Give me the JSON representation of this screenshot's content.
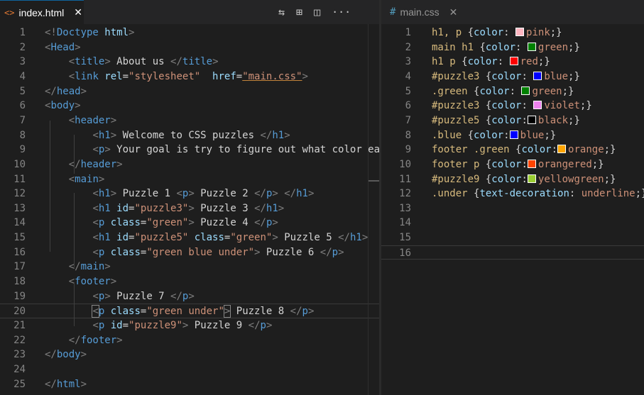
{
  "left_editor": {
    "tab": {
      "icon": "<>",
      "title": "index.html",
      "close": "✕"
    },
    "actions": [
      "⇆",
      "⊞",
      "◫",
      "···"
    ],
    "lines": [
      {
        "n": "1",
        "segs": [
          [
            "<!",
            "#808080"
          ],
          [
            "Doctype",
            "#569cd6"
          ],
          [
            " html",
            "#9cdcfe"
          ],
          [
            ">",
            "#808080"
          ]
        ]
      },
      {
        "n": "2",
        "segs": [
          [
            "<",
            "#808080"
          ],
          [
            "Head",
            "#569cd6"
          ],
          [
            ">",
            "#808080"
          ]
        ]
      },
      {
        "n": "3",
        "segs": [
          [
            "    ",
            "#d4d4d4"
          ],
          [
            "<",
            "#808080"
          ],
          [
            "title",
            "#569cd6"
          ],
          [
            ">",
            "#808080"
          ],
          [
            " About us ",
            "#d4d4d4"
          ],
          [
            "</",
            "#808080"
          ],
          [
            "title",
            "#569cd6"
          ],
          [
            ">",
            "#808080"
          ]
        ]
      },
      {
        "n": "4",
        "segs": [
          [
            "    ",
            "#d4d4d4"
          ],
          [
            "<",
            "#808080"
          ],
          [
            "link",
            "#569cd6"
          ],
          [
            " rel",
            "#9cdcfe"
          ],
          [
            "=",
            "#d4d4d4"
          ],
          [
            "\"stylesheet\"",
            "#ce9178"
          ],
          [
            "  href",
            "#9cdcfe"
          ],
          [
            "=",
            "#d4d4d4"
          ],
          [
            "\"main.css\"",
            "#ce9178",
            "squiggle"
          ],
          [
            ">",
            "#808080"
          ]
        ]
      },
      {
        "n": "5",
        "segs": [
          [
            "</",
            "#808080"
          ],
          [
            "head",
            "#569cd6"
          ],
          [
            ">",
            "#808080"
          ]
        ]
      },
      {
        "n": "6",
        "segs": [
          [
            "<",
            "#808080"
          ],
          [
            "body",
            "#569cd6"
          ],
          [
            ">",
            "#808080"
          ]
        ]
      },
      {
        "n": "7",
        "segs": [
          [
            "    ",
            "#d4d4d4"
          ],
          [
            "<",
            "#808080"
          ],
          [
            "header",
            "#569cd6"
          ],
          [
            ">",
            "#808080"
          ]
        ]
      },
      {
        "n": "8",
        "segs": [
          [
            "        ",
            "#d4d4d4"
          ],
          [
            "<",
            "#808080"
          ],
          [
            "h1",
            "#569cd6"
          ],
          [
            ">",
            "#808080"
          ],
          [
            " Welcome to CSS puzzles ",
            "#d4d4d4"
          ],
          [
            "</",
            "#808080"
          ],
          [
            "h1",
            "#569cd6"
          ],
          [
            ">",
            "#808080"
          ]
        ]
      },
      {
        "n": "9",
        "segs": [
          [
            "        ",
            "#d4d4d4"
          ],
          [
            "<",
            "#808080"
          ],
          [
            "p",
            "#569cd6"
          ],
          [
            ">",
            "#808080"
          ],
          [
            " Your goal is try to figure out what color ea",
            "#d4d4d4"
          ]
        ]
      },
      {
        "n": "10",
        "segs": [
          [
            "    ",
            "#d4d4d4"
          ],
          [
            "</",
            "#808080"
          ],
          [
            "header",
            "#569cd6"
          ],
          [
            ">",
            "#808080"
          ]
        ]
      },
      {
        "n": "11",
        "segs": [
          [
            "    ",
            "#d4d4d4"
          ],
          [
            "<",
            "#808080"
          ],
          [
            "main",
            "#569cd6"
          ],
          [
            ">",
            "#808080"
          ]
        ]
      },
      {
        "n": "12",
        "segs": [
          [
            "        ",
            "#d4d4d4"
          ],
          [
            "<",
            "#808080"
          ],
          [
            "h1",
            "#569cd6"
          ],
          [
            ">",
            "#808080"
          ],
          [
            " Puzzle 1 ",
            "#d4d4d4"
          ],
          [
            "<",
            "#808080"
          ],
          [
            "p",
            "#569cd6"
          ],
          [
            ">",
            "#808080"
          ],
          [
            " Puzzle 2 ",
            "#d4d4d4"
          ],
          [
            "</",
            "#808080"
          ],
          [
            "p",
            "#569cd6"
          ],
          [
            ">",
            "#808080"
          ],
          [
            " ",
            "#d4d4d4"
          ],
          [
            "</",
            "#808080"
          ],
          [
            "h1",
            "#569cd6"
          ],
          [
            ">",
            "#808080"
          ]
        ]
      },
      {
        "n": "13",
        "segs": [
          [
            "        ",
            "#d4d4d4"
          ],
          [
            "<",
            "#808080"
          ],
          [
            "h1",
            "#569cd6"
          ],
          [
            " id",
            "#9cdcfe"
          ],
          [
            "=",
            "#d4d4d4"
          ],
          [
            "\"puzzle3\"",
            "#ce9178"
          ],
          [
            ">",
            "#808080"
          ],
          [
            " Puzzle 3 ",
            "#d4d4d4"
          ],
          [
            "</",
            "#808080"
          ],
          [
            "h1",
            "#569cd6"
          ],
          [
            ">",
            "#808080"
          ]
        ]
      },
      {
        "n": "14",
        "segs": [
          [
            "        ",
            "#d4d4d4"
          ],
          [
            "<",
            "#808080"
          ],
          [
            "p",
            "#569cd6"
          ],
          [
            " class",
            "#9cdcfe"
          ],
          [
            "=",
            "#d4d4d4"
          ],
          [
            "\"green\"",
            "#ce9178"
          ],
          [
            ">",
            "#808080"
          ],
          [
            " Puzzle 4 ",
            "#d4d4d4"
          ],
          [
            "</",
            "#808080"
          ],
          [
            "p",
            "#569cd6"
          ],
          [
            ">",
            "#808080"
          ]
        ]
      },
      {
        "n": "15",
        "segs": [
          [
            "        ",
            "#d4d4d4"
          ],
          [
            "<",
            "#808080"
          ],
          [
            "h1",
            "#569cd6"
          ],
          [
            " id",
            "#9cdcfe"
          ],
          [
            "=",
            "#d4d4d4"
          ],
          [
            "\"puzzle5\"",
            "#ce9178"
          ],
          [
            " class",
            "#9cdcfe"
          ],
          [
            "=",
            "#d4d4d4"
          ],
          [
            "\"green\"",
            "#ce9178"
          ],
          [
            ">",
            "#808080"
          ],
          [
            " Puzzle 5 ",
            "#d4d4d4"
          ],
          [
            "</",
            "#808080"
          ],
          [
            "h1",
            "#569cd6"
          ],
          [
            ">",
            "#808080"
          ]
        ]
      },
      {
        "n": "16",
        "segs": [
          [
            "        ",
            "#d4d4d4"
          ],
          [
            "<",
            "#808080"
          ],
          [
            "p",
            "#569cd6"
          ],
          [
            " class",
            "#9cdcfe"
          ],
          [
            "=",
            "#d4d4d4"
          ],
          [
            "\"green blue under\"",
            "#ce9178"
          ],
          [
            ">",
            "#808080"
          ],
          [
            " Puzzle 6 ",
            "#d4d4d4"
          ],
          [
            "</",
            "#808080"
          ],
          [
            "p",
            "#569cd6"
          ],
          [
            ">",
            "#808080"
          ]
        ]
      },
      {
        "n": "17",
        "segs": [
          [
            "    ",
            "#d4d4d4"
          ],
          [
            "</",
            "#808080"
          ],
          [
            "main",
            "#569cd6"
          ],
          [
            ">",
            "#808080"
          ]
        ]
      },
      {
        "n": "18",
        "segs": [
          [
            "    ",
            "#d4d4d4"
          ],
          [
            "<",
            "#808080"
          ],
          [
            "footer",
            "#569cd6"
          ],
          [
            ">",
            "#808080"
          ]
        ]
      },
      {
        "n": "19",
        "segs": [
          [
            "        ",
            "#d4d4d4"
          ],
          [
            "<",
            "#808080"
          ],
          [
            "p",
            "#569cd6"
          ],
          [
            ">",
            "#808080"
          ],
          [
            " Puzzle 7 ",
            "#d4d4d4"
          ],
          [
            "</",
            "#808080"
          ],
          [
            "p",
            "#569cd6"
          ],
          [
            ">",
            "#808080"
          ]
        ]
      },
      {
        "n": "20",
        "current": true,
        "segs": [
          [
            "        ",
            "#d4d4d4"
          ],
          [
            "<",
            "#808080",
            "bracket-box"
          ],
          [
            "p",
            "#569cd6"
          ],
          [
            " class",
            "#9cdcfe"
          ],
          [
            "=",
            "#d4d4d4"
          ],
          [
            "\"green under\"",
            "#ce9178"
          ],
          [
            ">",
            "#808080",
            "bracket-box"
          ],
          [
            " Puzzle 8 ",
            "#d4d4d4"
          ],
          [
            "</",
            "#808080"
          ],
          [
            "p",
            "#569cd6"
          ],
          [
            ">",
            "#808080"
          ]
        ]
      },
      {
        "n": "21",
        "segs": [
          [
            "        ",
            "#d4d4d4"
          ],
          [
            "<",
            "#808080"
          ],
          [
            "p",
            "#569cd6"
          ],
          [
            " id",
            "#9cdcfe"
          ],
          [
            "=",
            "#d4d4d4"
          ],
          [
            "\"puzzle9\"",
            "#ce9178"
          ],
          [
            ">",
            "#808080"
          ],
          [
            " Puzzle 9 ",
            "#d4d4d4"
          ],
          [
            "</",
            "#808080"
          ],
          [
            "p",
            "#569cd6"
          ],
          [
            ">",
            "#808080"
          ]
        ]
      },
      {
        "n": "22",
        "segs": [
          [
            "    ",
            "#d4d4d4"
          ],
          [
            "</",
            "#808080"
          ],
          [
            "footer",
            "#569cd6"
          ],
          [
            ">",
            "#808080"
          ]
        ]
      },
      {
        "n": "23",
        "segs": [
          [
            "</",
            "#808080"
          ],
          [
            "body",
            "#569cd6"
          ],
          [
            ">",
            "#808080"
          ]
        ]
      },
      {
        "n": "24",
        "segs": []
      },
      {
        "n": "25",
        "segs": [
          [
            "</",
            "#808080"
          ],
          [
            "html",
            "#569cd6"
          ],
          [
            ">",
            "#808080"
          ]
        ]
      }
    ]
  },
  "right_editor": {
    "tab": {
      "icon": "#",
      "title": "main.css",
      "close": "✕"
    },
    "lines": [
      {
        "n": "1",
        "segs": [
          [
            "h1, p ",
            "#d7ba7d"
          ],
          [
            "{",
            "#d4d4d4"
          ],
          [
            "color",
            "#9cdcfe"
          ],
          [
            ": ",
            "#d4d4d4"
          ],
          [
            "#ffb6c1",
            "swatch"
          ],
          [
            "pink",
            "#ce9178"
          ],
          [
            ";}",
            "#d4d4d4"
          ]
        ]
      },
      {
        "n": "2",
        "segs": [
          [
            "main h1 ",
            "#d7ba7d"
          ],
          [
            "{",
            "#d4d4d4"
          ],
          [
            "color",
            "#9cdcfe"
          ],
          [
            ": ",
            "#d4d4d4"
          ],
          [
            "#008000",
            "swatch"
          ],
          [
            "green",
            "#ce9178"
          ],
          [
            ";}",
            "#d4d4d4"
          ]
        ]
      },
      {
        "n": "3",
        "segs": [
          [
            "h1 p ",
            "#d7ba7d"
          ],
          [
            "{",
            "#d4d4d4"
          ],
          [
            "color",
            "#9cdcfe"
          ],
          [
            ": ",
            "#d4d4d4"
          ],
          [
            "#ff0000",
            "swatch"
          ],
          [
            "red",
            "#ce9178"
          ],
          [
            ";}",
            "#d4d4d4"
          ]
        ]
      },
      {
        "n": "4",
        "segs": [
          [
            "#puzzle3 ",
            "#d7ba7d"
          ],
          [
            "{",
            "#d4d4d4"
          ],
          [
            "color",
            "#9cdcfe"
          ],
          [
            ": ",
            "#d4d4d4"
          ],
          [
            "#0000ff",
            "swatch"
          ],
          [
            "blue",
            "#ce9178"
          ],
          [
            ";}",
            "#d4d4d4"
          ]
        ]
      },
      {
        "n": "5",
        "segs": [
          [
            ".green ",
            "#d7ba7d"
          ],
          [
            "{",
            "#d4d4d4"
          ],
          [
            "color",
            "#9cdcfe"
          ],
          [
            ": ",
            "#d4d4d4"
          ],
          [
            "#008000",
            "swatch"
          ],
          [
            "green",
            "#ce9178"
          ],
          [
            ";}",
            "#d4d4d4"
          ]
        ]
      },
      {
        "n": "6",
        "segs": [
          [
            "#puzzle3 ",
            "#d7ba7d"
          ],
          [
            "{",
            "#d4d4d4"
          ],
          [
            "color",
            "#9cdcfe"
          ],
          [
            ": ",
            "#d4d4d4"
          ],
          [
            "#ee82ee",
            "swatch"
          ],
          [
            "violet",
            "#ce9178"
          ],
          [
            ";}",
            "#d4d4d4"
          ]
        ]
      },
      {
        "n": "7",
        "segs": [
          [
            "#puzzle5 ",
            "#d7ba7d"
          ],
          [
            "{",
            "#d4d4d4"
          ],
          [
            "color",
            "#9cdcfe"
          ],
          [
            ":",
            "#d4d4d4"
          ],
          [
            "#000000",
            "swatch"
          ],
          [
            "black",
            "#ce9178"
          ],
          [
            ";}",
            "#d4d4d4"
          ]
        ]
      },
      {
        "n": "8",
        "segs": [
          [
            ".blue ",
            "#d7ba7d"
          ],
          [
            "{",
            "#d4d4d4"
          ],
          [
            "color",
            "#9cdcfe"
          ],
          [
            ":",
            "#d4d4d4"
          ],
          [
            "#0000ff",
            "swatch"
          ],
          [
            "blue",
            "#ce9178"
          ],
          [
            ";}",
            "#d4d4d4"
          ]
        ]
      },
      {
        "n": "9",
        "segs": [
          [
            "footer .green ",
            "#d7ba7d"
          ],
          [
            "{",
            "#d4d4d4"
          ],
          [
            "color",
            "#9cdcfe"
          ],
          [
            ":",
            "#d4d4d4"
          ],
          [
            "#ffa500",
            "swatch"
          ],
          [
            "orange",
            "#ce9178"
          ],
          [
            ";}",
            "#d4d4d4"
          ]
        ]
      },
      {
        "n": "10",
        "segs": [
          [
            "footer p ",
            "#d7ba7d"
          ],
          [
            "{",
            "#d4d4d4"
          ],
          [
            "color",
            "#9cdcfe"
          ],
          [
            ":",
            "#d4d4d4"
          ],
          [
            "#ff4500",
            "swatch"
          ],
          [
            "orangered",
            "#ce9178"
          ],
          [
            ";}",
            "#d4d4d4"
          ]
        ]
      },
      {
        "n": "11",
        "segs": [
          [
            "#puzzle9 ",
            "#d7ba7d"
          ],
          [
            "{",
            "#d4d4d4"
          ],
          [
            "color",
            "#9cdcfe"
          ],
          [
            ":",
            "#d4d4d4"
          ],
          [
            "#9acd32",
            "swatch"
          ],
          [
            "yellowgreen",
            "#ce9178"
          ],
          [
            ";}",
            "#d4d4d4"
          ]
        ]
      },
      {
        "n": "12",
        "segs": [
          [
            ".under ",
            "#d7ba7d"
          ],
          [
            "{",
            "#d4d4d4"
          ],
          [
            "text-decoration",
            "#9cdcfe"
          ],
          [
            ": ",
            "#d4d4d4"
          ],
          [
            "underline",
            "#ce9178"
          ],
          [
            ";}",
            "#d4d4d4"
          ]
        ]
      },
      {
        "n": "13",
        "segs": []
      },
      {
        "n": "14",
        "segs": []
      },
      {
        "n": "15",
        "segs": []
      },
      {
        "n": "16",
        "current": true,
        "segs": []
      }
    ]
  }
}
